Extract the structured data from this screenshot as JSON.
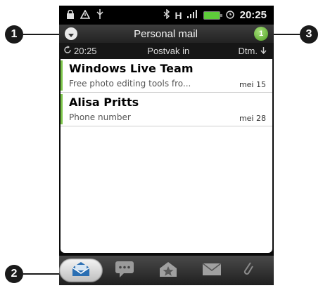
{
  "status_bar": {
    "time": "20:25",
    "icons_left": [
      "lock-icon",
      "warning-icon",
      "usb-icon"
    ],
    "icons_right": [
      "bluetooth-icon",
      "hspa-icon",
      "signal-icon",
      "battery-icon",
      "alarm-icon"
    ]
  },
  "header": {
    "title": "Personal mail",
    "unread_count": "1"
  },
  "subheader": {
    "sync_time": "20:25",
    "folder": "Postvak in",
    "sort_label": "Dtm."
  },
  "messages": [
    {
      "sender": "Windows Live Team",
      "preview": "Free photo editing tools fro...",
      "date": "mei 15"
    },
    {
      "sender": "Alisa Pritts",
      "preview": "Phone number",
      "date": "mei 28"
    }
  ],
  "tabs": [
    "inbox-tab",
    "conversations-tab",
    "favorites-tab",
    "unread-tab",
    "attachments-tab"
  ],
  "callouts": [
    "1",
    "2",
    "3"
  ],
  "colors": {
    "accent_green": "#7cc54a",
    "header_bg": "#2e2e2e"
  }
}
